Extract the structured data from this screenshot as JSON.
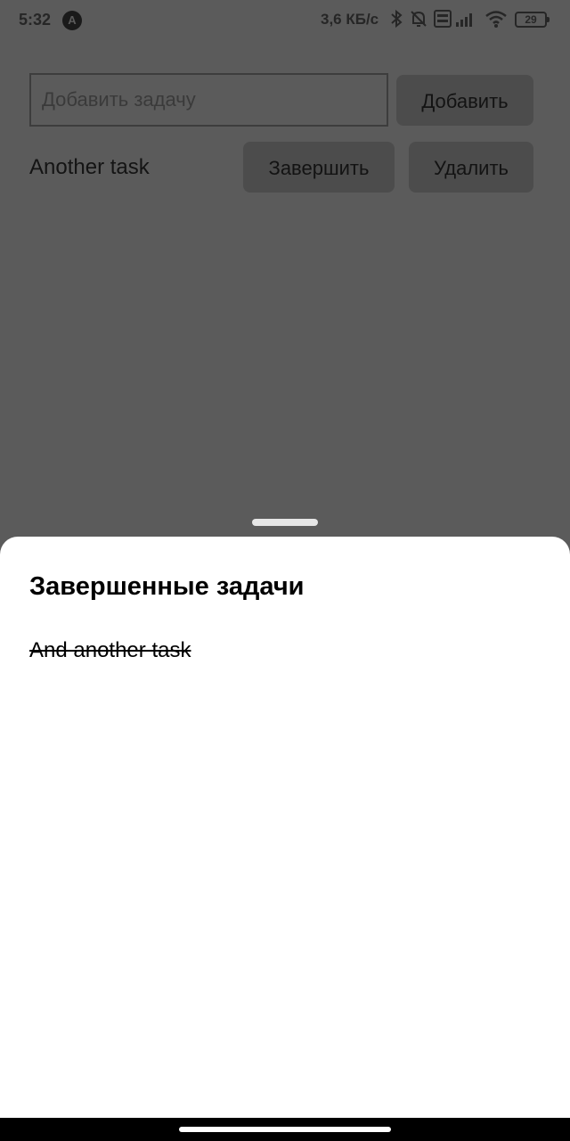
{
  "status_bar": {
    "time": "5:32",
    "app_icon": "A",
    "speed": "3,6 КБ/с",
    "battery": "29",
    "icons": [
      "bluetooth-icon",
      "bell-muted-icon",
      "volte-icon",
      "signal-icon",
      "wifi-icon",
      "battery-icon"
    ]
  },
  "form": {
    "input_placeholder": "Добавить задачу",
    "input_value": "",
    "add_label": "Добавить"
  },
  "tasks": [
    {
      "text": "Another task",
      "complete_label": "Завершить",
      "delete_label": "Удалить"
    }
  ],
  "completed_sheet": {
    "title": "Завершенные задачи",
    "items": [
      "And another task"
    ]
  },
  "colors": {
    "overlay": "#5b5b5b",
    "sheet": "#ffffff",
    "button": "#4c4c4c"
  }
}
